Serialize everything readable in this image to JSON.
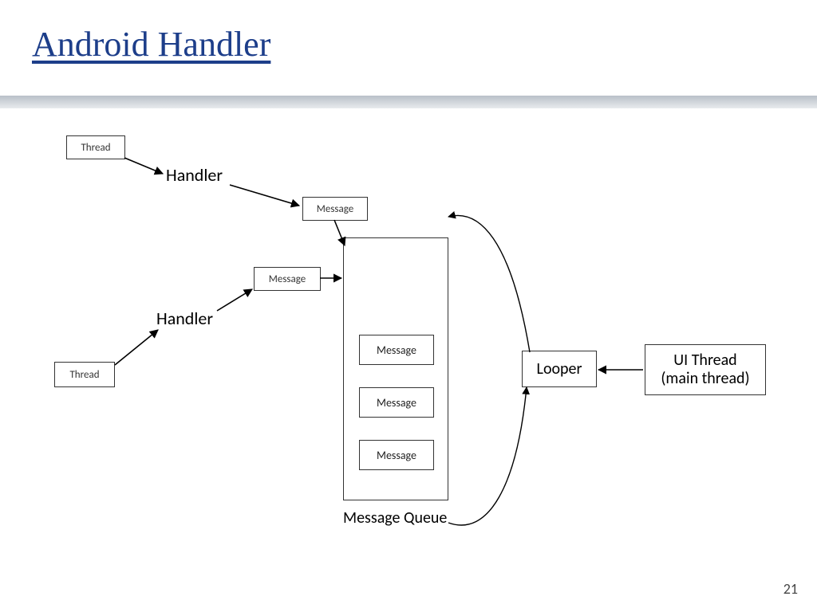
{
  "title": "Android Handler",
  "page_number": "21",
  "boxes": {
    "thread1": "Thread",
    "thread2": "Thread",
    "handler1": "Handler",
    "handler2": "Handler",
    "message_top": "Message",
    "message_left": "Message",
    "message_q1": "Message",
    "message_q2": "Message",
    "message_q3": "Message",
    "looper": "Looper",
    "ui_thread_l1": "UI Thread",
    "ui_thread_l2": "(main thread)"
  },
  "labels": {
    "message_queue": "Message Queue"
  }
}
